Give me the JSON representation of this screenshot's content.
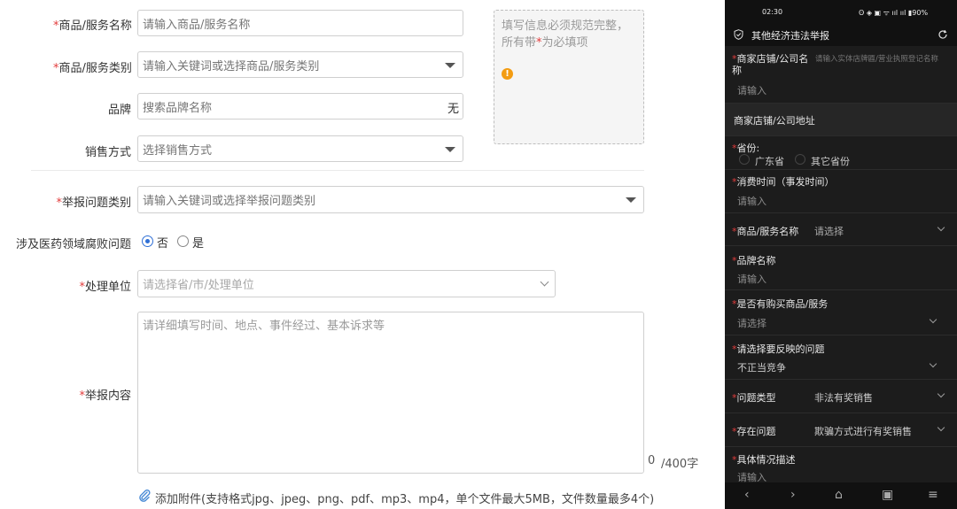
{
  "form": {
    "product_name": {
      "label": "商品/服务名称",
      "placeholder": "请输入商品/服务名称"
    },
    "product_category": {
      "label": "商品/服务类别",
      "placeholder": "请输入关键词或选择商品/服务类别"
    },
    "brand": {
      "label": "品牌",
      "placeholder": "搜索品牌名称",
      "suffix": "无"
    },
    "sale_method": {
      "label": "销售方式",
      "placeholder": "选择销售方式"
    },
    "hint": {
      "text_before": "填写信息必须规范完整，所有带",
      "text_star": "*",
      "text_after": "为必填项",
      "warn_icon": "!"
    },
    "report_category": {
      "label": "举报问题类别",
      "placeholder": "请输入关键词或选择举报问题类别"
    },
    "medical_corruption": {
      "label": "涉及医药领域腐败问题",
      "options": [
        "否",
        "是"
      ],
      "selected": "否"
    },
    "handling_unit": {
      "label": "处理单位",
      "placeholder": "请选择省/市/处理单位"
    },
    "report_content": {
      "label": "举报内容",
      "placeholder": "请详细填写时间、地点、事件经过、基本诉求等",
      "counter_current": "0",
      "counter_max": "/400字"
    },
    "attachment": {
      "text": "添加附件(支持格式jpg、jpeg、png、pdf、mp3、mp4，单个文件最大5MB，文件数量最多4个)"
    },
    "required_mark": "*"
  },
  "mobile": {
    "status": {
      "time": "02:30",
      "icons": "ʘ ◈ ▣ ᯤ ııl ııl ▮90%"
    },
    "title": "其他经济违法举报",
    "rows": {
      "merchant_name": {
        "label_line1": "商家店铺/公司名",
        "label_line2": "称",
        "hint": "请输入实体店牌匾/营业执照登记名称",
        "value": "请输入"
      },
      "merchant_address": {
        "label": "商家店铺/公司地址"
      },
      "province": {
        "label": "省份:",
        "options": [
          "广东省",
          "其它省份"
        ]
      },
      "consume_time": {
        "label": "消费时间（事发时间）",
        "value": "请输入"
      },
      "product_name": {
        "label": "商品/服务名称",
        "value": "请选择"
      },
      "brand_name": {
        "label": "品牌名称",
        "value": "请输入"
      },
      "purchased": {
        "label": "是否有购买商品/服务",
        "value": "请选择"
      },
      "issue": {
        "label": "请选择要反映的问题",
        "value": "不正当竞争"
      },
      "issue_type": {
        "label": "问题类型",
        "value": "非法有奖销售"
      },
      "existing_issue": {
        "label": "存在问题",
        "value": "欺骗方式进行有奖销售"
      },
      "details": {
        "label": "具体情况描述",
        "value": "请输入"
      }
    },
    "nav": {
      "back": "‹",
      "forward": "›",
      "home": "⌂",
      "tabs": "▣",
      "menu": "≡"
    }
  },
  "colors": {
    "required": "#e23c3c",
    "radio_active": "#2f6fd6",
    "warn": "#f39c12",
    "mobile_bg": "#1c1c1c"
  }
}
